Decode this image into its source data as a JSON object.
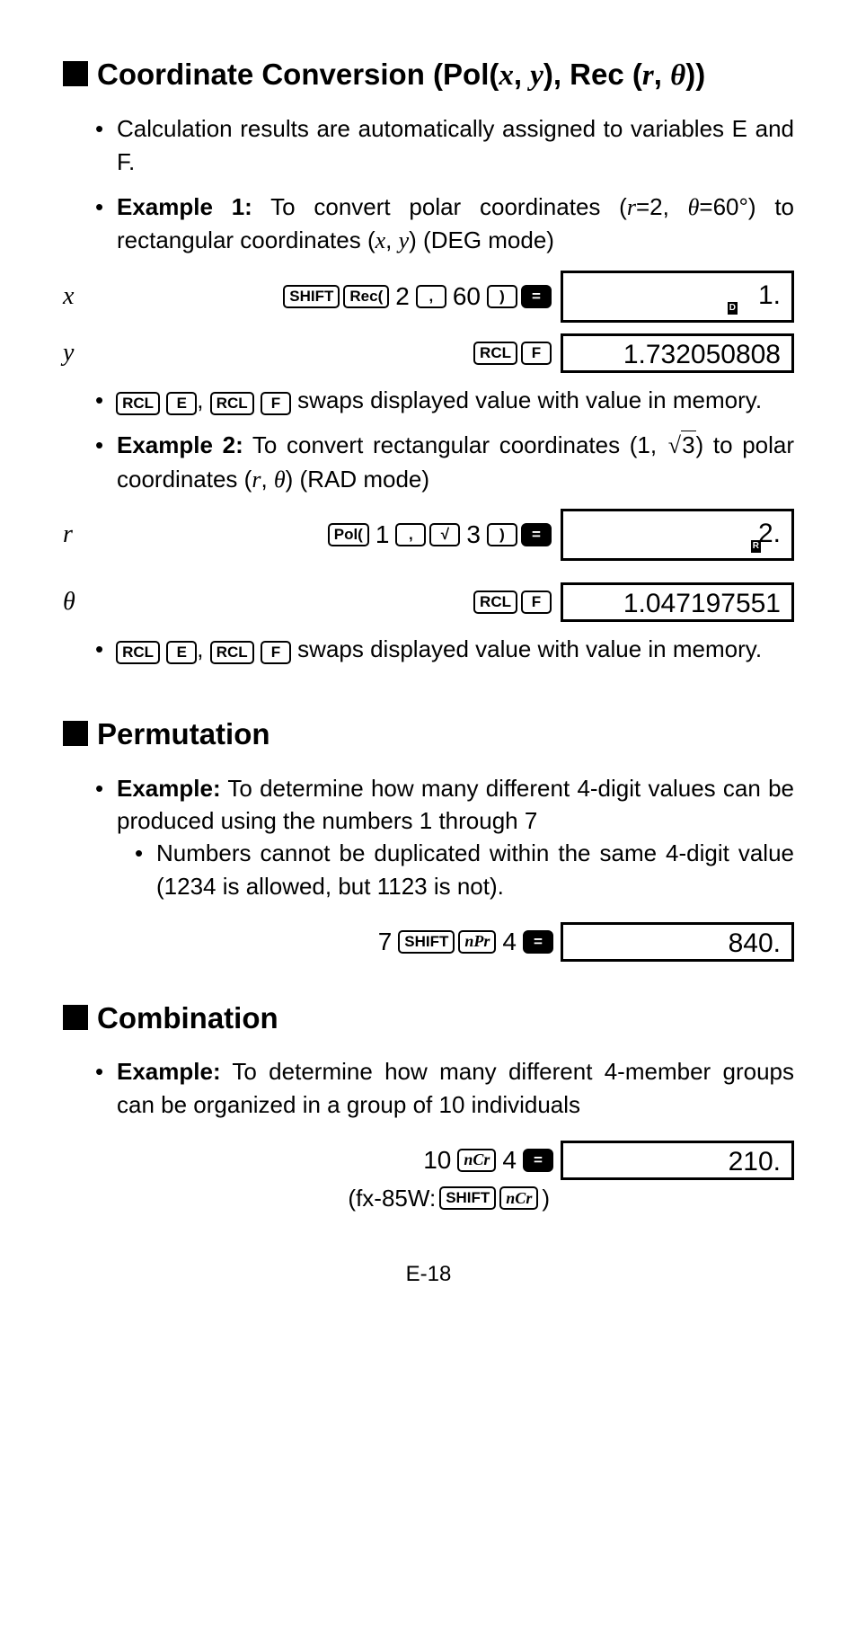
{
  "section1": {
    "title_prefix": "Coordinate Conversion (Pol(",
    "title_vars1": "x",
    "title_mid1": ", ",
    "title_vars2": "y",
    "title_mid2": "), Rec (",
    "title_vars3": "r",
    "title_mid3": ", ",
    "title_vars4": "θ",
    "title_suffix": "))",
    "bullet1": "Calculation results are automatically assigned to variables E and F.",
    "ex1_label": "Example 1:",
    "ex1_text1": " To convert polar coordinates (",
    "ex1_r": "r",
    "ex1_text2": "=2, ",
    "ex1_th": "θ",
    "ex1_text3": "=60°) to rectangular coordinates (",
    "ex1_x": "x",
    "ex1_text4": ", ",
    "ex1_y": "y",
    "ex1_text5": ") (DEG mode)",
    "row_x": {
      "label": "x",
      "keys": {
        "shift": "SHIFT",
        "rec": "Rec(",
        "n1": "2",
        "comma": ",",
        "n2": "60",
        "close": ")",
        "eq": "="
      },
      "result": "1.",
      "ind": "D"
    },
    "row_y": {
      "label": "y",
      "keys": {
        "rcl": "RCL",
        "f": "F"
      },
      "result": "1.732050808"
    },
    "note1_keys": {
      "rcl": "RCL",
      "e": "E",
      "rcl2": "RCL",
      "f": "F"
    },
    "note1_text": " swaps displayed value with value in memory.",
    "ex2_label": "Example 2:",
    "ex2_text1": " To convert rectangular coordinates (1, ",
    "ex2_sqrt": "3",
    "ex2_text2": ") to polar coordinates (",
    "ex2_r": "r",
    "ex2_text3": ", ",
    "ex2_th": "θ",
    "ex2_text4": ") (RAD mode)",
    "row_r": {
      "label": "r",
      "keys": {
        "pol": "Pol(",
        "n1": "1",
        "comma": ",",
        "sqrt": "√",
        "n2": "3",
        "close": ")",
        "eq": "="
      },
      "result": "2.",
      "ind": "R"
    },
    "row_th": {
      "label": "θ",
      "keys": {
        "rcl": "RCL",
        "f": "F"
      },
      "result": "1.047197551"
    }
  },
  "section2": {
    "title": "Permutation",
    "ex_label": "Example:",
    "ex_text": " To determine how many different 4-digit values can be produced using the numbers 1 through 7",
    "sub_text": "Numbers cannot be duplicated within the same 4-digit value (1234 is allowed, but 1123 is not).",
    "calc": {
      "n1": "7",
      "shift": "SHIFT",
      "npr": "nPr",
      "n2": "4",
      "eq": "=",
      "result": "840."
    }
  },
  "section3": {
    "title": "Combination",
    "ex_label": "Example:",
    "ex_text": " To determine how many different 4-member groups can be organized in a group of 10 individuals",
    "calc": {
      "n1": "10",
      "ncr": "nCr",
      "n2": "4",
      "eq": "=",
      "result": "210."
    },
    "note_prefix": "(fx-85W: ",
    "note_shift": "SHIFT",
    "note_ncr": "nCr",
    "note_suffix": ")"
  },
  "page": "E-18"
}
